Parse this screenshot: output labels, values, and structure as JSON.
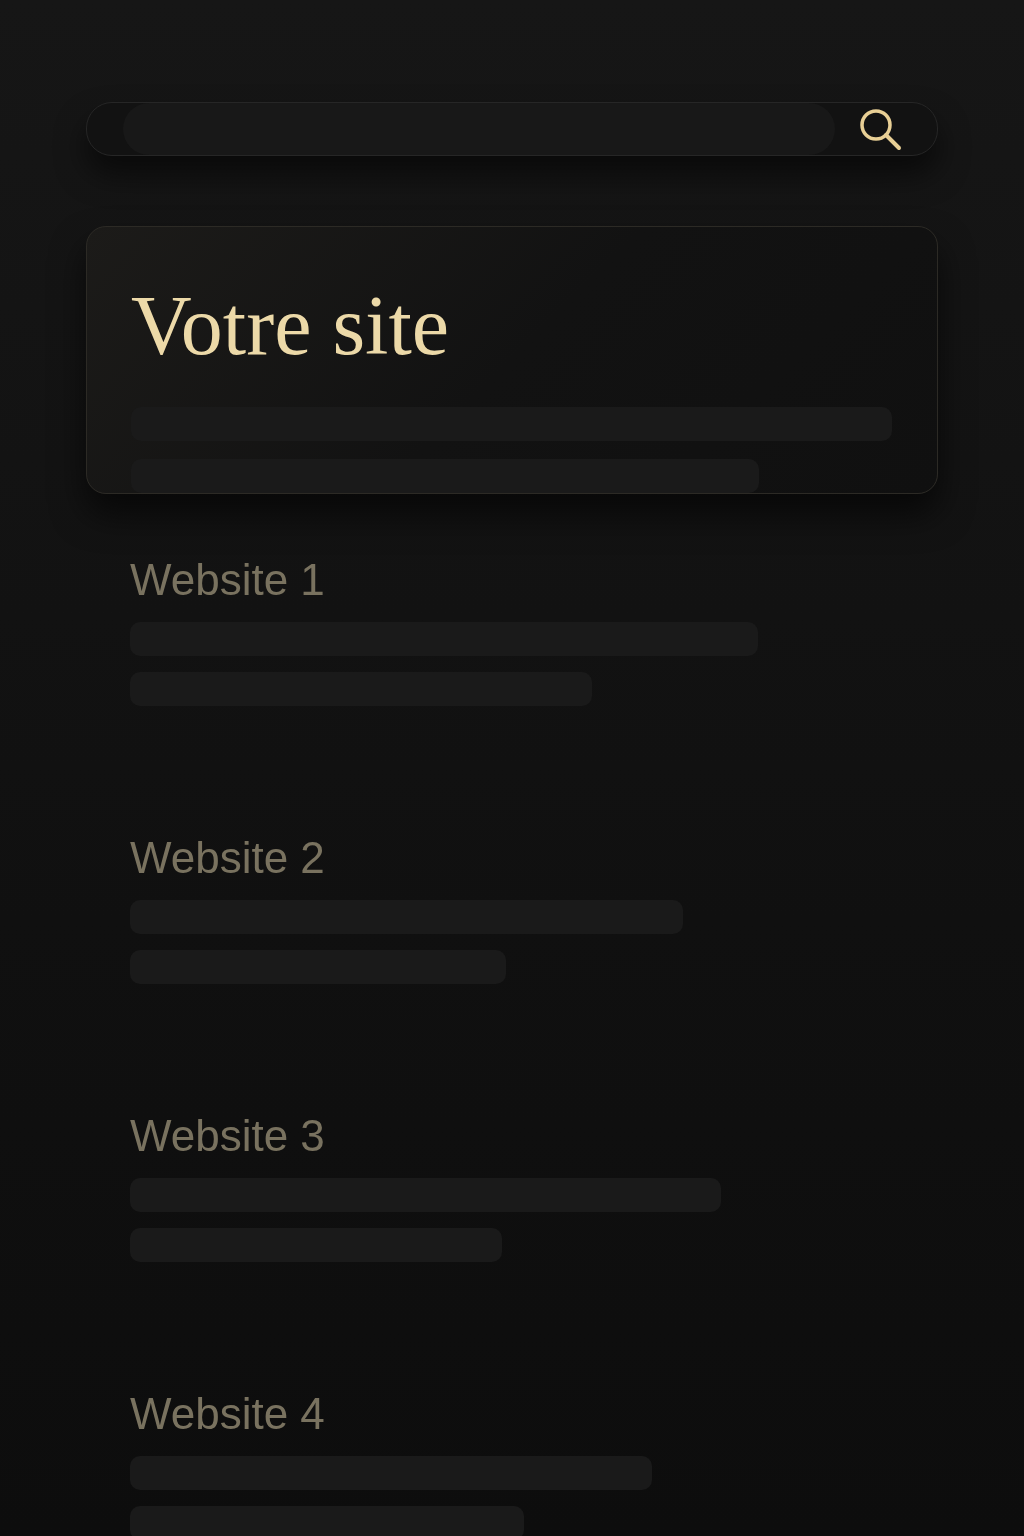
{
  "hero": {
    "title": "Votre site"
  },
  "results": [
    {
      "title": "Website 1"
    },
    {
      "title": "Website 2"
    },
    {
      "title": "Website 3"
    },
    {
      "title": "Website 4"
    }
  ]
}
